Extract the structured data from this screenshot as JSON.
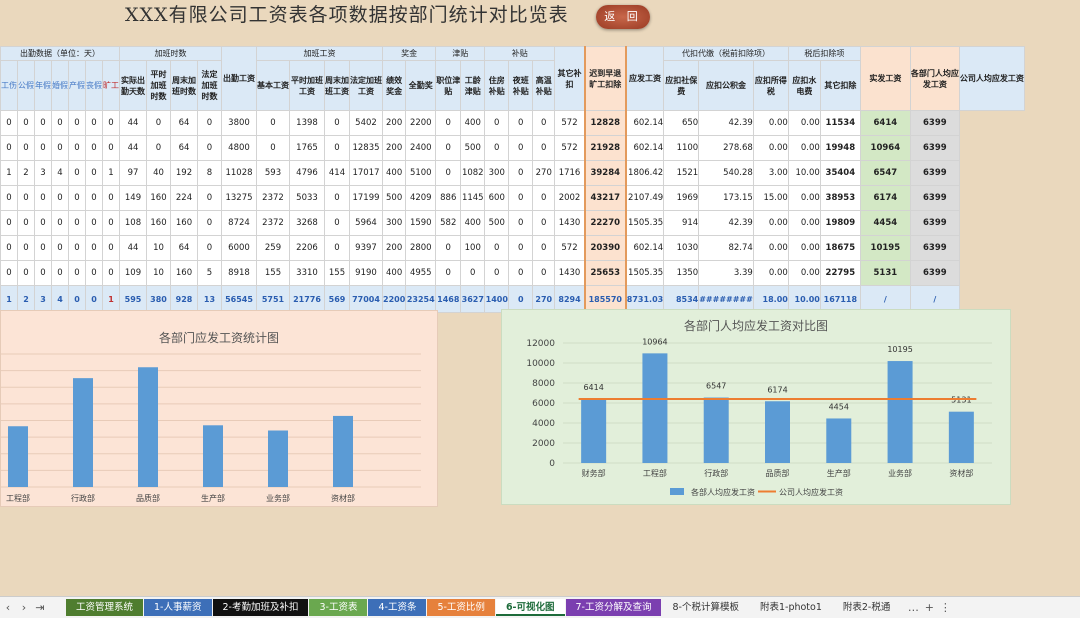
{
  "title": "XXX有限公司工资表各项数据按部门统计对比览表",
  "back_label": "返 回",
  "group_headers": [
    "出勤数据（单位：天）",
    "加班时数",
    "出勤工资",
    "加班工资",
    "奖金",
    "津贴",
    "补贴",
    "其它补扣",
    "迟到早退旷工扣除",
    "应发工资",
    "代扣代缴（税前扣除项）",
    "税后扣除项",
    "实发工资",
    "各部门人均应发工资",
    "公司人均应发工资"
  ],
  "sub_headers": [
    "工伤",
    "公假",
    "年假",
    "婚假",
    "产假",
    "丧假",
    "旷工",
    "实际出勤天数",
    "平时加班时数",
    "周末加班时数",
    "法定加班时数",
    "基本工资",
    "平时加班工资",
    "周末加班工资",
    "法定加班工资",
    "绩效奖金",
    "全勤奖",
    "职位津贴",
    "工龄津贴",
    "住房补贴",
    "夜班补贴",
    "高温补贴",
    "其它补扣",
    "迟到早退旷工扣除",
    "应发工资",
    "应扣社保费",
    "应扣公积金",
    "应扣所得税",
    "应扣水电费",
    "其它扣除",
    "实发工资",
    "各部门人均应发工资",
    "公司人均应发工资"
  ],
  "rows": [
    [
      "0",
      "0",
      "0",
      "0",
      "0",
      "0",
      "0",
      "44",
      "0",
      "64",
      "0",
      "3800",
      "0",
      "1398",
      "0",
      "5402",
      "200",
      "2200",
      "0",
      "400",
      "0",
      "0",
      "0",
      "572",
      "12828",
      "602.14",
      "650",
      "42.39",
      "0.00",
      "0.00",
      "11534",
      "6414",
      "6399"
    ],
    [
      "0",
      "0",
      "0",
      "0",
      "0",
      "0",
      "0",
      "44",
      "0",
      "64",
      "0",
      "4800",
      "0",
      "1765",
      "0",
      "12835",
      "200",
      "2400",
      "0",
      "500",
      "0",
      "0",
      "0",
      "572",
      "21928",
      "602.14",
      "1100",
      "278.68",
      "0.00",
      "0.00",
      "19948",
      "10964",
      "6399"
    ],
    [
      "1",
      "2",
      "3",
      "4",
      "0",
      "0",
      "1",
      "97",
      "40",
      "192",
      "8",
      "11028",
      "593",
      "4796",
      "414",
      "17017",
      "400",
      "5100",
      "0",
      "1082",
      "300",
      "0",
      "270",
      "1716",
      "39284",
      "1806.42",
      "1521",
      "540.28",
      "3.00",
      "10.00",
      "35404",
      "6547",
      "6399"
    ],
    [
      "0",
      "0",
      "0",
      "0",
      "0",
      "0",
      "0",
      "149",
      "160",
      "224",
      "0",
      "13275",
      "2372",
      "5033",
      "0",
      "17199",
      "500",
      "4209",
      "886",
      "1145",
      "600",
      "0",
      "0",
      "2002",
      "43217",
      "2107.49",
      "1969",
      "173.15",
      "15.00",
      "0.00",
      "38953",
      "6174",
      "6399"
    ],
    [
      "0",
      "0",
      "0",
      "0",
      "0",
      "0",
      "0",
      "108",
      "160",
      "160",
      "0",
      "8724",
      "2372",
      "3268",
      "0",
      "5964",
      "300",
      "1590",
      "582",
      "400",
      "500",
      "0",
      "0",
      "1430",
      "22270",
      "1505.35",
      "914",
      "42.39",
      "0.00",
      "0.00",
      "19809",
      "4454",
      "6399"
    ],
    [
      "0",
      "0",
      "0",
      "0",
      "0",
      "0",
      "0",
      "44",
      "10",
      "64",
      "0",
      "6000",
      "259",
      "2206",
      "0",
      "9397",
      "200",
      "2800",
      "0",
      "100",
      "0",
      "0",
      "0",
      "572",
      "20390",
      "602.14",
      "1030",
      "82.74",
      "0.00",
      "0.00",
      "18675",
      "10195",
      "6399"
    ],
    [
      "0",
      "0",
      "0",
      "0",
      "0",
      "0",
      "0",
      "109",
      "10",
      "160",
      "5",
      "8918",
      "155",
      "3310",
      "155",
      "9190",
      "400",
      "4955",
      "0",
      "0",
      "0",
      "0",
      "0",
      "1430",
      "25653",
      "1505.35",
      "1350",
      "3.39",
      "0.00",
      "0.00",
      "22795",
      "5131",
      "6399"
    ]
  ],
  "totals": [
    "1",
    "2",
    "3",
    "4",
    "0",
    "0",
    "1",
    "595",
    "380",
    "928",
    "13",
    "56545",
    "5751",
    "21776",
    "569",
    "77004",
    "2200",
    "23254",
    "1468",
    "3627",
    "1400",
    "0",
    "270",
    "8294",
    "185570",
    "8731.03",
    "8534",
    "########",
    "18.00",
    "10.00",
    "167118",
    "/",
    "/"
  ],
  "chart_data": [
    {
      "type": "bar",
      "title": "各部门应发工资统计图",
      "categories": [
        "工程部",
        "行政部",
        "品质部",
        "生产部",
        "业务部",
        "资材部"
      ],
      "values": [
        21928,
        39284,
        43217,
        22270,
        20390,
        25653
      ],
      "grid": true
    },
    {
      "type": "bar",
      "title": "各部门人均应发工资对比图",
      "categories": [
        "财务部",
        "工程部",
        "行政部",
        "品质部",
        "生产部",
        "业务部",
        "资材部"
      ],
      "series": [
        {
          "name": "各部人均应发工资",
          "type": "bar",
          "values": [
            6414,
            10964,
            6547,
            6174,
            4454,
            10195,
            5131
          ]
        },
        {
          "name": "公司人均应发工资",
          "type": "line",
          "values": [
            6399,
            6399,
            6399,
            6399,
            6399,
            6399,
            6399
          ]
        }
      ],
      "yticks": [
        "0",
        "2000",
        "4000",
        "6000",
        "8000",
        "10000",
        "12000"
      ],
      "ylim": [
        0,
        12000
      ],
      "legend": "bottom",
      "grid": true
    }
  ],
  "tabs": [
    {
      "label": "工资管理系统",
      "color": "#4f7d2f"
    },
    {
      "label": "1-人事薪资",
      "color": "#3d6fb8"
    },
    {
      "label": "2-考勤加班及补扣",
      "color": "#111111"
    },
    {
      "label": "3-工资表",
      "color": "#6aa84f"
    },
    {
      "label": "4-工资条",
      "color": "#3d6fb8"
    },
    {
      "label": "5-工资比例",
      "color": "#e6813c"
    },
    {
      "label": "6-可视化图",
      "color": "active"
    },
    {
      "label": "7-工资分解及查询",
      "color": "#7b3fb0"
    },
    {
      "label": "8-个税计算模板",
      "color": "plain"
    },
    {
      "label": "附表1-photo1",
      "color": "plain"
    },
    {
      "label": "附表2-税通",
      "color": "plain"
    }
  ],
  "colors": {
    "bar": "#5b9bd5",
    "line": "#ed7d31",
    "accent": "#e39a5c"
  }
}
